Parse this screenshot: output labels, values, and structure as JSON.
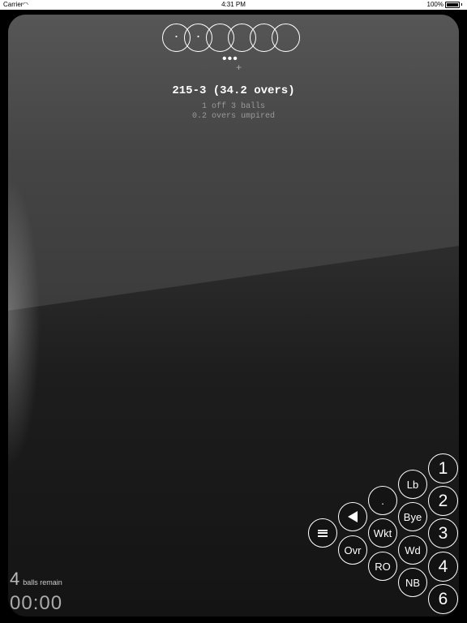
{
  "status_bar": {
    "carrier": "Carrier",
    "time": "4:31 PM",
    "battery_percent": "100%",
    "wifi_icon": "wifi-icon",
    "battery_icon": "battery-icon"
  },
  "over_balls": [
    {
      "mark": "·"
    },
    {
      "mark": "·"
    },
    {
      "mark": ""
    },
    {
      "mark": ""
    },
    {
      "mark": ""
    },
    {
      "mark": ""
    }
  ],
  "more_indicator": "•••",
  "add_indicator": "+",
  "score": {
    "line": "215-3 (34.2 overs)",
    "sub1": "1 off 3 balls",
    "sub2": "0.2 overs umpired"
  },
  "counter": {
    "balls_remaining": "4",
    "balls_label": "balls remain",
    "timer": "00:00"
  },
  "buttons": {
    "run1": "1",
    "run2": "2",
    "run3": "3",
    "run4": "4",
    "run6": "6",
    "lb": "Lb",
    "bye": "Bye",
    "wd": "Wd",
    "nb": "NB",
    "dot": ".",
    "wkt": "Wkt",
    "ro": "RO",
    "ovr": "Ovr",
    "undo_icon": "triangle-left-icon",
    "menu_icon": "hamburger-menu-icon"
  }
}
